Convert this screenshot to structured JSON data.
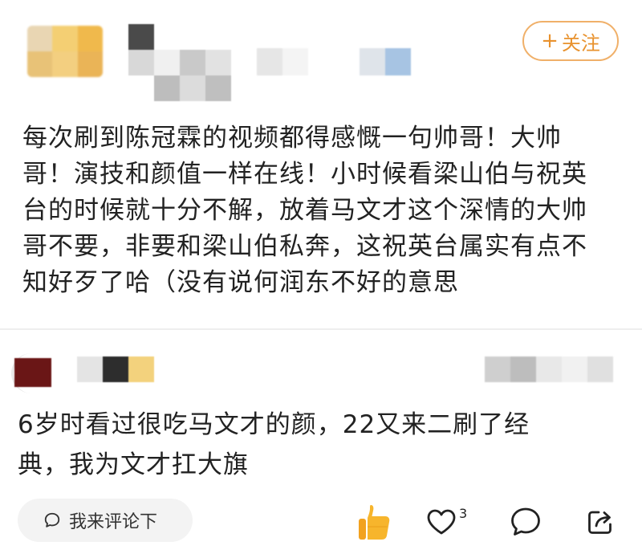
{
  "post": {
    "follow_label": "关注",
    "follow_plus": "+",
    "body_lines": [
      "每次刷到陈冠霖的视频都得感慨一句帅哥！大帅",
      "哥！演技和颜值一样在线！小时候看梁山伯与祝英",
      "台的时候就十分不解，放着马文才这个深情的大帅",
      "哥不要，非要和梁山伯私奔，这祝英台属实有点不",
      "知好歹了哈（没有说何润东不好的意思"
    ]
  },
  "comment": {
    "text_lines": [
      "6岁时看过很吃马文才的颜，22又来二刷了经",
      "典，我为文才扛大旗"
    ]
  },
  "bottom_bar": {
    "input_placeholder": "我来评论下",
    "like_count": "3",
    "icons": [
      "speech-bubble-icon",
      "thumbs-up-icon",
      "heart-icon",
      "comment-icon",
      "share-icon"
    ]
  },
  "colors": {
    "accent_orange": "#e8922e",
    "follow_border": "#f0b069",
    "thumb_yellow": "#f7b52c",
    "text": "#222222",
    "input_bg": "#f3f3f3"
  }
}
